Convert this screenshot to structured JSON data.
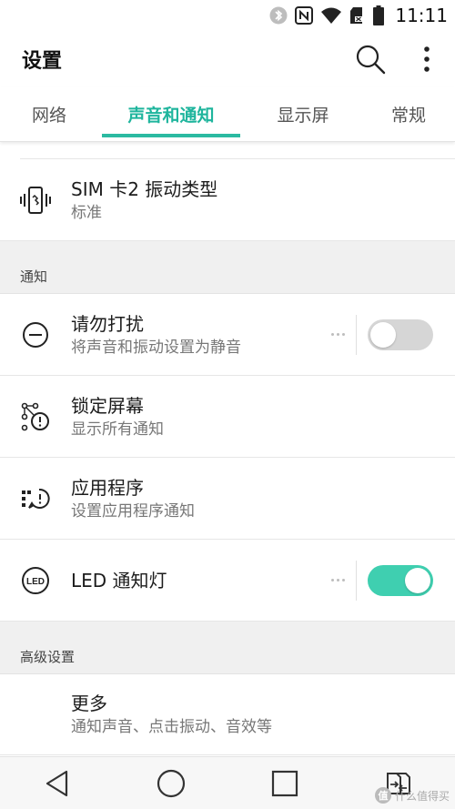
{
  "status_bar": {
    "time": "11:11",
    "icons": [
      "bluetooth-icon",
      "nfc-icon",
      "wifi-icon",
      "sdcard-icon",
      "battery-icon"
    ]
  },
  "app_bar": {
    "title": "设置",
    "search_icon": "search-icon",
    "more_icon": "more-vert-icon"
  },
  "tabs": [
    {
      "label": "网络",
      "selected": false
    },
    {
      "label": "声音和通知",
      "selected": true
    },
    {
      "label": "显示屏",
      "selected": false
    },
    {
      "label": "常规",
      "selected": false
    }
  ],
  "rows": {
    "sim2_vibration": {
      "title": "SIM 卡2 振动类型",
      "subtitle": "标准",
      "icon": "phone-vibrate-icon"
    }
  },
  "section_notify": {
    "header": "通知",
    "items": [
      {
        "title": "请勿打扰",
        "subtitle": "将声音和振动设置为静音",
        "icon": "do-not-disturb-icon",
        "toggle": false
      },
      {
        "title": "锁定屏幕",
        "subtitle": "显示所有通知",
        "icon": "lock-screen-notify-icon"
      },
      {
        "title": "应用程序",
        "subtitle": "设置应用程序通知",
        "icon": "app-notify-icon"
      },
      {
        "title": "LED 通知灯",
        "icon": "led-icon",
        "icon_text": "LED",
        "toggle": true
      }
    ]
  },
  "section_advanced": {
    "header": "高级设置",
    "items": [
      {
        "title": "更多",
        "subtitle": "通知声音、点击振动、音效等"
      }
    ]
  },
  "nav_bar": {
    "buttons": [
      "back-icon",
      "home-icon",
      "recents-icon",
      "sim-switch-icon"
    ]
  },
  "watermark": {
    "mark": "值",
    "text": "什么值得买"
  },
  "colors": {
    "accent": "#1fb59d",
    "toggle_on": "#3fcfb0",
    "toggle_off": "#d6d6d6",
    "section_bg": "#f0f0f0"
  }
}
